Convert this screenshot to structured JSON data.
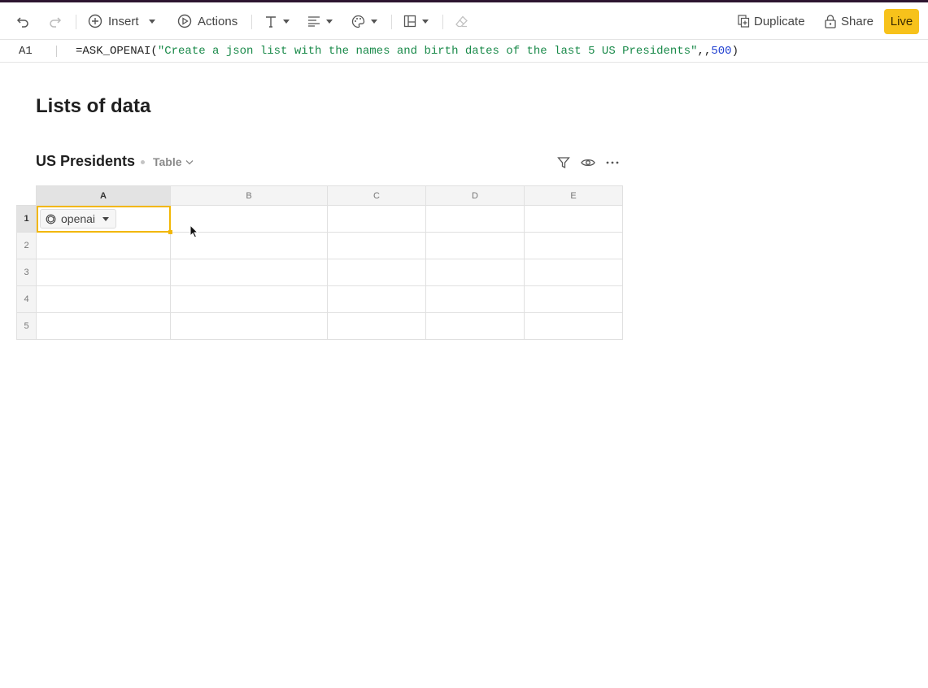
{
  "toolbar": {
    "insert_label": "Insert",
    "actions_label": "Actions",
    "duplicate_label": "Duplicate",
    "share_label": "Share",
    "live_label": "Live",
    "icons": [
      "undo-icon",
      "redo-icon",
      "plus-circle-icon",
      "play-circle-icon",
      "text-format-icon",
      "align-icon",
      "palette-icon",
      "layout-icon",
      "eraser-icon",
      "duplicate-icon",
      "lock-icon"
    ]
  },
  "formula_bar": {
    "cell_ref": "A1",
    "formula_prefix": "=ASK_OPENAI(",
    "formula_string": "\"Create a json list with the names and birth dates of the last 5 US Presidents\"",
    "formula_sep": ",,",
    "formula_number": "500",
    "formula_suffix": ")"
  },
  "page": {
    "title": "Lists of data"
  },
  "table": {
    "title": "US Presidents",
    "view_label": "Table",
    "columns": [
      "A",
      "B",
      "C",
      "D",
      "E"
    ],
    "rows": [
      "1",
      "2",
      "3",
      "4",
      "5"
    ],
    "selected_cell": "A1",
    "a1_chip_label": "openai"
  },
  "colors": {
    "accent": "#f7c21b",
    "selection": "#f2b705",
    "string": "#1a8a4a",
    "number": "#1f3fd1"
  }
}
